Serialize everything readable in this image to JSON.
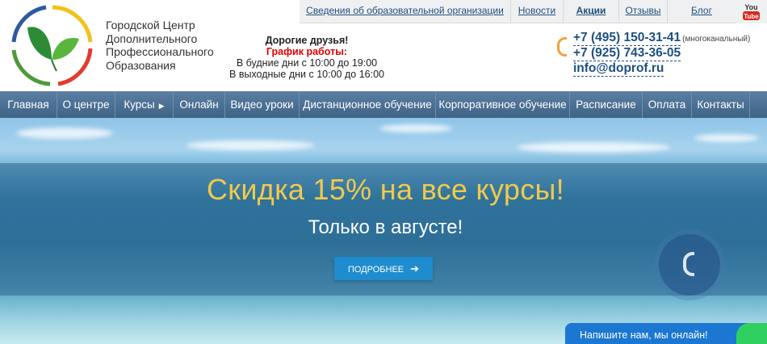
{
  "header": {
    "org_name": "Городской Центр Дополнительного Профессионального Образования",
    "notice": {
      "greeting": "Дорогие друзья!",
      "schedule_title": "График работы:",
      "weekdays": "В будние дни с 10:00 до 19:00",
      "weekends": "В выходные дни с 10:00 до 16:00"
    },
    "top_links": [
      {
        "label": "Сведения об образовательной организации",
        "bold": false
      },
      {
        "label": "Новости",
        "bold": false
      },
      {
        "label": "Акции",
        "bold": true
      },
      {
        "label": "Отзывы",
        "bold": false
      },
      {
        "label": "Блог",
        "bold": false
      }
    ],
    "youtube_label": "You Tube",
    "phone1": "+7 (495) 150-31-41",
    "phone1_note": "(многоканальный)",
    "phone2": "+7 (925) 743-36-05",
    "email": "info@doprof.ru"
  },
  "main_nav": [
    {
      "label": "Главная",
      "has_arrow": false
    },
    {
      "label": "О центре",
      "has_arrow": false
    },
    {
      "label": "Курсы",
      "has_arrow": true
    },
    {
      "label": "Онлайн",
      "has_arrow": false
    },
    {
      "label": "Видео уроки",
      "has_arrow": false
    },
    {
      "label": "Дистанционное обучение",
      "has_arrow": false
    },
    {
      "label": "Корпоративное обучение",
      "has_arrow": false
    },
    {
      "label": "Расписание",
      "has_arrow": false
    },
    {
      "label": "Оплата",
      "has_arrow": false
    },
    {
      "label": "Контакты",
      "has_arrow": false
    }
  ],
  "hero": {
    "headline": "Скидка 15% на все курсы!",
    "subline": "Только в августе!",
    "button_label": "ПОДРОБНЕЕ",
    "button_arrow": "➔"
  },
  "chat": {
    "label": "Напишите нам, мы онлайн!"
  },
  "colors": {
    "accent_nav": "#4a6f92",
    "headline": "#f1c94b",
    "button": "#1e8ccf",
    "chat": "#1b77d2",
    "schedule_red": "#e00000"
  }
}
